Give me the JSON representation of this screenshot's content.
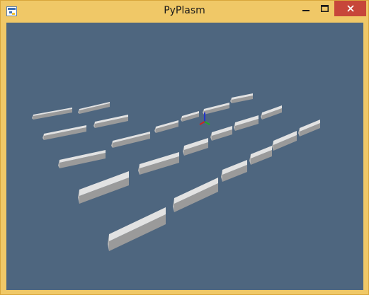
{
  "window": {
    "title": "PyPlasm",
    "icon": "python-icon",
    "controls": [
      "minimize-icon",
      "maximize-icon",
      "close-icon"
    ]
  },
  "viewport": {
    "background": "#4e667f",
    "object_count": 24,
    "axes_colors": {
      "x": "#cc2222",
      "y": "#22aa22",
      "z": "#2233cc"
    }
  },
  "colors": {
    "frame": "#f0c867",
    "close_button": "#c7463a",
    "box_top": "#e2e2e2",
    "box_side": "#9a9a9a"
  }
}
